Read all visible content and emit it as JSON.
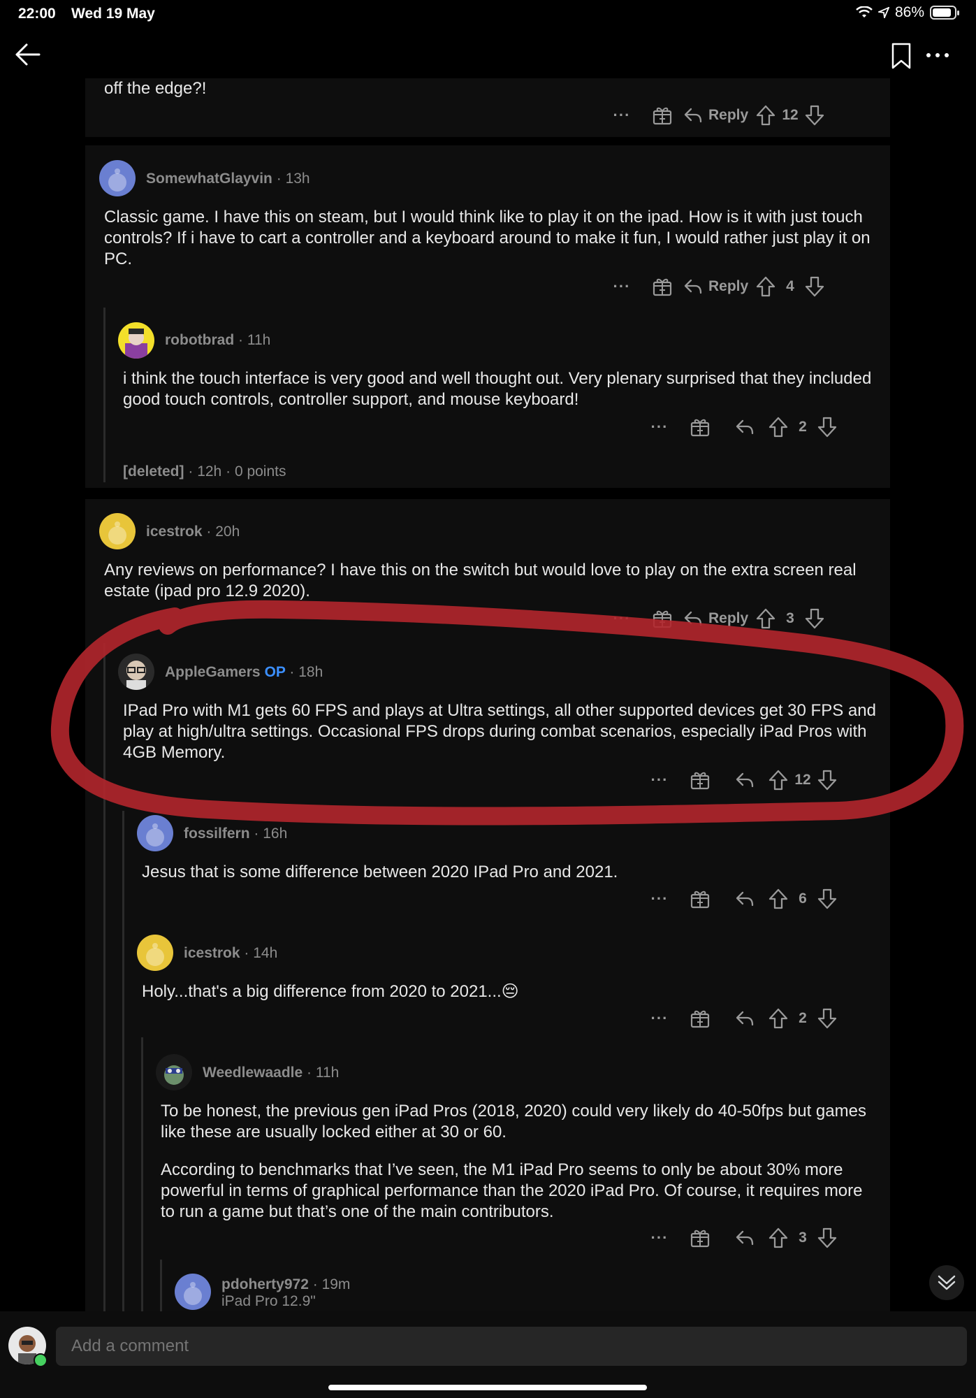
{
  "status_bar": {
    "time": "22:00",
    "date": "Wed 19 May",
    "battery": "86%",
    "battery_level": 0.86
  },
  "comments": [
    {
      "id": "c0",
      "body": [
        "off the edge?!"
      ],
      "reply_label": "Reply",
      "score": "12"
    },
    {
      "id": "c1",
      "author": "SomewhatGlayvin",
      "age": "13h",
      "body": [
        "Classic game.  I have this on steam, but I would think like to play it on the ipad.  How is it with just touch controls?  If i have to cart a controller and a keyboard around to make it fun, I would rather just play it on PC."
      ],
      "reply_label": "Reply",
      "score": "4"
    },
    {
      "id": "c2",
      "author": "robotbrad",
      "age": "11h",
      "body": [
        "i think the touch interface is very good and well thought out. Very plenary surprised that they included good touch controls, controller support, and mouse keyboard!"
      ],
      "score": "2"
    },
    {
      "id": "c3",
      "author": "[deleted]",
      "age": "12h",
      "points": "0 points"
    },
    {
      "id": "c4",
      "author": "icestrok",
      "age": "20h",
      "body": [
        "Any reviews on performance? I have this on the switch but would love to play on the extra screen real estate (ipad pro 12.9 2020)."
      ],
      "reply_label": "Reply",
      "score": "3"
    },
    {
      "id": "c5",
      "author": "AppleGamers",
      "flair": "OP",
      "age": "18h",
      "body": [
        "IPad Pro with M1 gets 60 FPS and plays at Ultra settings, all other supported devices get 30 FPS and play at high/ultra settings. Occasional FPS drops during combat scenarios, especially iPad Pros with 4GB Memory."
      ],
      "score": "12"
    },
    {
      "id": "c6",
      "author": "fossilfern",
      "age": "16h",
      "body": [
        "Jesus that is some difference between 2020 IPad Pro and 2021."
      ],
      "score": "6"
    },
    {
      "id": "c7",
      "author": "icestrok",
      "age": "14h",
      "body": [
        "Holy...that's a big difference from 2020 to 2021...😔"
      ],
      "score": "2"
    },
    {
      "id": "c8",
      "author": "Weedlewaadle",
      "age": "11h",
      "body": [
        "To be honest, the previous gen iPad Pros (2018, 2020) could very likely do 40-50fps but games like these are usually locked either at 30 or 60.",
        "According to benchmarks that I’ve seen, the M1 iPad Pro seems to only be about 30% more powerful in terms of graphical performance than the 2020 iPad Pro. Of course, it requires more to run a game but that’s one of the main contributors."
      ],
      "score": "3"
    },
    {
      "id": "c9",
      "author": "pdoherty972",
      "age": "19m",
      "flair_text": "iPad Pro 12.9\""
    }
  ],
  "more_menu": "···",
  "separator": "·",
  "comment_input": {
    "placeholder": "Add a comment"
  },
  "colors": {
    "background": "#000000",
    "card": "#0e0e0e",
    "op_flair": "#3b8fff",
    "annotation": "#b3262c"
  }
}
